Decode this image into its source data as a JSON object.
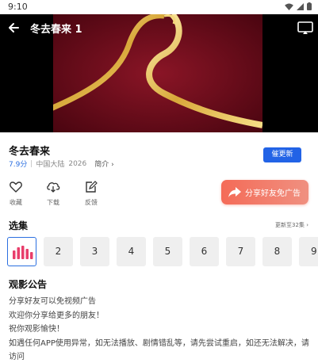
{
  "status": {
    "time": "9:10"
  },
  "player": {
    "title": "冬去春来 1"
  },
  "show": {
    "title": "冬去春来",
    "score": "7.9分",
    "region": "中国大陆",
    "year": "2026",
    "intro_label": "简介",
    "urge_label": "催更新"
  },
  "actions": {
    "favorite_label": "收藏",
    "download_label": "下载",
    "feedback_label": "反馈",
    "share_banner_label": "分享好友免广告"
  },
  "episodes": {
    "title": "选集",
    "more_label": "更新至32集",
    "items": [
      "2",
      "3",
      "4",
      "5",
      "6",
      "7",
      "8",
      "9"
    ]
  },
  "notice": {
    "title": "观影公告",
    "lines": [
      "分享好友可以免视频广告",
      "欢迎你分享给更多的朋友！",
      "祝你观影愉快！",
      "如遇任何APP使用异常，如无法播放、剧情错乱等，请先尝试重启，如还无法解决，请访问"
    ]
  },
  "colors": {
    "accent": "#2263e6",
    "share_banner": "#f46b58",
    "video_bg": "#7a0f1e"
  }
}
